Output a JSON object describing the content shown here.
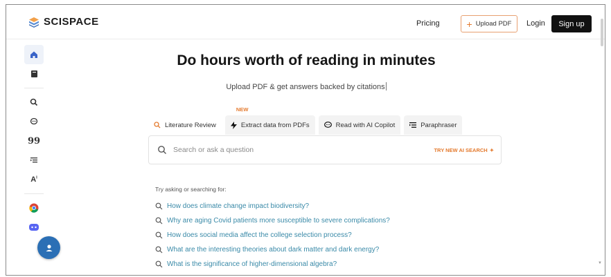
{
  "header": {
    "brand": "SCISPACE",
    "pricing": "Pricing",
    "upload_pdf": "Upload PDF",
    "login": "Login",
    "sign_up": "Sign up"
  },
  "sidebar": {
    "items": [
      {
        "icon": "home-icon",
        "glyph": "⌂"
      },
      {
        "icon": "library-icon",
        "glyph": "▮"
      },
      {
        "icon": "literature-search-icon",
        "glyph": "Q"
      },
      {
        "icon": "chat-icon",
        "glyph": "◌"
      },
      {
        "icon": "citation-icon",
        "glyph": "99"
      },
      {
        "icon": "paraphraser-icon",
        "glyph": "≣"
      },
      {
        "icon": "ai-detector-icon",
        "glyph": "A"
      },
      {
        "icon": "chrome-extension-icon",
        "glyph": "●"
      },
      {
        "icon": "discord-icon",
        "glyph": "●"
      }
    ]
  },
  "main": {
    "title": "Do hours worth of reading in minutes",
    "subtitle": "Upload PDF & get answers backed by citations",
    "tabs": [
      {
        "label": "Literature Review",
        "icon": "search-icon",
        "badge": ""
      },
      {
        "label": "Extract data from PDFs",
        "icon": "lightning-icon",
        "badge": "NEW"
      },
      {
        "label": "Read with AI Copilot",
        "icon": "chat-icon",
        "badge": ""
      },
      {
        "label": "Paraphraser",
        "icon": "paraphraser-icon",
        "badge": ""
      }
    ],
    "search_placeholder": "Search or ask a question",
    "try_ai": "TRY NEW AI SEARCH",
    "try_label": "Try asking or searching for:",
    "suggestions": [
      "How does climate change impact biodiversity?",
      "Why are aging Covid patients more susceptible to severe complications?",
      "How does social media affect the college selection process?",
      "What are the interesting theories about dark matter and dark energy?",
      "What is the significance of higher-dimensional algebra?"
    ]
  },
  "colors": {
    "accent": "#e47a2e",
    "link": "#3a8aa8",
    "brand_blue": "#2b6fb5"
  }
}
